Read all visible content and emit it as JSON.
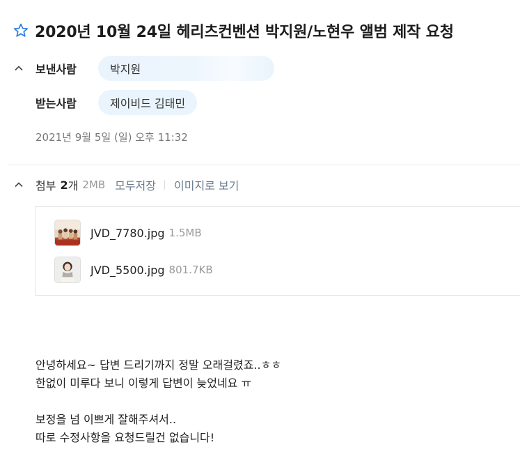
{
  "subject": "2020년 10월 24일 헤리츠컨벤션 박지원/노현우 앨범 제작 요청",
  "sender": {
    "label": "보낸사람",
    "name": "박지원"
  },
  "recipient": {
    "label": "받는사람",
    "name": "제이비드 김태민"
  },
  "date": "2021년 9월 5일 (일) 오후 11:32",
  "attachments": {
    "title": "첨부",
    "count": "2",
    "unit": "개",
    "total_size": "2MB",
    "save_all_label": "모두저장",
    "view_as_image_label": "이미지로 보기",
    "files": [
      {
        "name": "JVD_7780.jpg",
        "size": "1.5MB"
      },
      {
        "name": "JVD_5500.jpg",
        "size": "801.7KB"
      }
    ]
  },
  "body": {
    "lines": [
      "안녕하세요~ 답변 드리기까지 정말 오래걸렸죠..ㅎㅎ",
      "한없이 미루다 보니 이렇게 답변이 늦었네요 ㅠ",
      "",
      "보정을 넘 이쁘게 잘해주셔서..",
      "따로 수정사항을 요청드릴건 없습니다!"
    ]
  },
  "colors": {
    "accent": "#2a7de1",
    "chip_bg": "#eaf4fd",
    "link": "#6a7a8c"
  }
}
